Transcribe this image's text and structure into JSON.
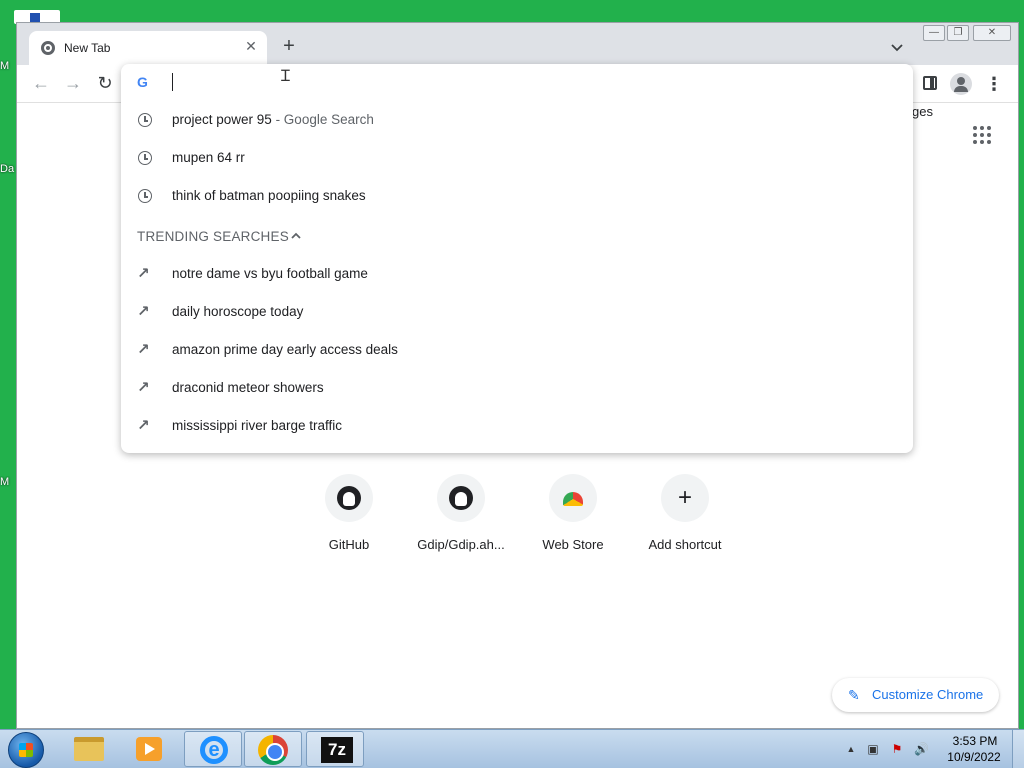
{
  "desktop": {
    "side_labels": [
      "M",
      "Da",
      "M"
    ]
  },
  "browser": {
    "tab": {
      "title": "New Tab",
      "close": "✕"
    },
    "new_tab": "+",
    "window_controls": {
      "minimize": "—",
      "restore": "❐",
      "close": "✕"
    },
    "nav": {
      "back": "←",
      "forward": "→",
      "reload": "↻"
    },
    "menu": "⋮"
  },
  "omnibox": {
    "value": "",
    "google_icon": "G",
    "history": [
      {
        "text": "project power 95",
        "suffix": " - Google Search",
        "icon": "clock-icon"
      },
      {
        "text": "mupen 64 rr",
        "suffix": "",
        "icon": "clock-icon"
      },
      {
        "text": "think of batman poopiing snakes",
        "suffix": "",
        "icon": "clock-icon"
      }
    ],
    "trending_header": "TRENDING SEARCHES",
    "trending": [
      {
        "text": "notre dame vs byu football game",
        "icon": "trending-icon"
      },
      {
        "text": "daily horoscope today",
        "icon": "trending-icon"
      },
      {
        "text": "amazon prime day early access deals",
        "icon": "trending-icon"
      },
      {
        "text": "draconid meteor showers",
        "icon": "trending-icon"
      },
      {
        "text": "mississippi river barge traffic",
        "icon": "trending-icon"
      }
    ]
  },
  "page": {
    "images_link": "mages",
    "shortcuts": [
      {
        "label": "GitHub",
        "icon": "github-icon"
      },
      {
        "label": "Gdip/Gdip.ah...",
        "icon": "github-icon"
      },
      {
        "label": "Web Store",
        "icon": "web-store-icon"
      },
      {
        "label": "Add shortcut",
        "icon": "plus-icon"
      }
    ],
    "customize": "Customize Chrome"
  },
  "taskbar": {
    "apps": [
      "explorer-icon",
      "media-player-icon",
      "internet-explorer-icon",
      "chrome-icon",
      "7zip-icon"
    ],
    "app_7z_label": "7z",
    "ie_label": "e",
    "tray_expand": "▲",
    "time": "3:53 PM",
    "date": "10/9/2022"
  },
  "colors": {
    "desktop": "#22b14c",
    "accent": "#1a73e8"
  }
}
